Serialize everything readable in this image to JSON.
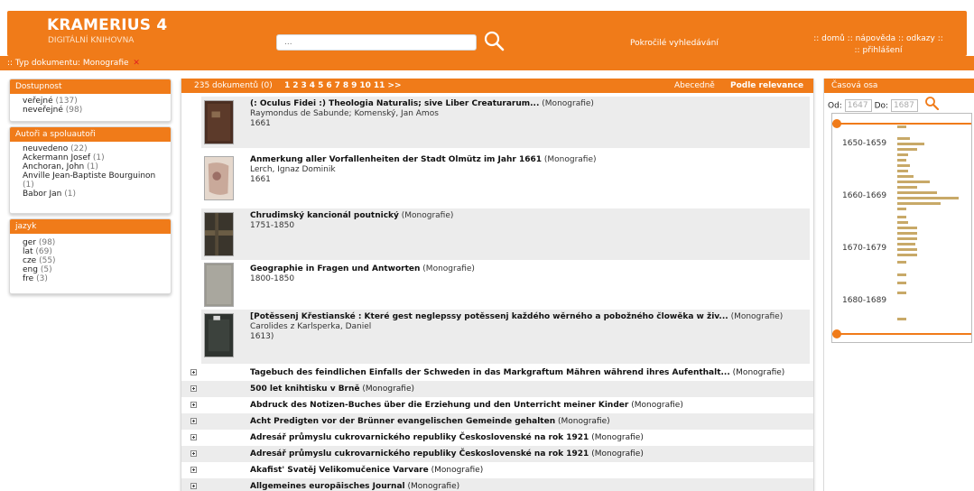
{
  "header": {
    "title": "KRAMERIUS 4",
    "subtitle": "DIGITÁLNÍ KNIHOVNA",
    "search_placeholder": "...",
    "advanced_search": "Pokročilé vyhledávání",
    "links_line1_a": ":: domů ::",
    "links_line1_b": "nápověda",
    "links_line1_c": "::",
    "links_line1_d": "odkazy",
    "links_line1_e": "::",
    "links_line2_a": "::",
    "links_line2_b": "přihlášení"
  },
  "breadcrumb": {
    "text": ":: Typ dokumentu: Monografie",
    "remove_icon": "close-x-icon"
  },
  "facets": {
    "availability": {
      "title": "Dostupnost",
      "items": [
        {
          "label": "veřejné",
          "count": "(137)"
        },
        {
          "label": "neveřejné",
          "count": "(98)"
        }
      ]
    },
    "authors": {
      "title": "Autoři a spoluautoři",
      "items": [
        {
          "label": "neuvedeno",
          "count": "(22)"
        },
        {
          "label": "Ackermann Josef",
          "count": "(1)"
        },
        {
          "label": "Anchoran, John",
          "count": "(1)"
        },
        {
          "label": "Anville Jean-Baptiste Bourguinon",
          "count": "(1)"
        },
        {
          "label": "Babor Jan",
          "count": "(1)"
        }
      ]
    },
    "language": {
      "title": "jazyk",
      "items": [
        {
          "label": "ger",
          "count": "(98)"
        },
        {
          "label": "lat",
          "count": "(69)"
        },
        {
          "label": "cze",
          "count": "(55)"
        },
        {
          "label": "eng",
          "count": "(5)"
        },
        {
          "label": "fre",
          "count": "(3)"
        }
      ]
    }
  },
  "results": {
    "count_text": "235 dokumentů (0)",
    "pages": [
      "1",
      "2",
      "3",
      "4",
      "5",
      "6",
      "7",
      "8",
      "9",
      "10",
      "11",
      ">>"
    ],
    "sort_alpha": "Abecedně",
    "sort_relevance": "Podle relevance",
    "items_with_thumbs": [
      {
        "title": "(: Oculus Fidei :) Theologia Naturalis; sive Liber Creaturarum...",
        "type": "(Monografie)",
        "authors": "Raymondus de Sabunde; Komenský, Jan Amos",
        "year": "1661"
      },
      {
        "title": "Anmerkung aller Vorfallenheiten der Stadt Olmütz im Jahr 1661",
        "type": "(Monografie)",
        "authors": "Lerch, Ignaz Dominik",
        "year": "1661"
      },
      {
        "title": "Chrudimský kancionál poutnický",
        "type": "(Monografie)",
        "authors": "",
        "year": "1751-1850"
      },
      {
        "title": "Geographie in Fragen und Antworten",
        "type": "(Monografie)",
        "authors": "",
        "year": "1800-1850"
      },
      {
        "title": "[Potěssenj Křestianské : Které gest neglepssy potěssenj každého wěrného a pobožného člowěka w živ...",
        "type": "(Monografie)",
        "authors": "Carolides z Karlsperka, Daniel",
        "year": "1613)"
      }
    ],
    "items_collapsed": [
      {
        "title": "Tagebuch des feindlichen Einfalls der Schweden in das Markgraftum Mähren während ihres Aufenthalt...",
        "type": "(Monografie)"
      },
      {
        "title": "500 let knihtisku v Brně",
        "type": "(Monografie)"
      },
      {
        "title": "Abdruck des Notizen-Buches über die Erziehung und den Unterricht meiner Kinder",
        "type": "(Monografie)"
      },
      {
        "title": "Acht Predigten vor der Brünner evangelischen Gemeinde gehalten",
        "type": "(Monografie)"
      },
      {
        "title": "Adresář průmyslu cukrovarnického republiky Československé na rok 1921",
        "type": "(Monografie)"
      },
      {
        "title": "Adresář průmyslu cukrovarnického republiky Československé na rok 1921",
        "type": "(Monografie)"
      },
      {
        "title": "Akafist' Svatěj Velikomučenice Varvare",
        "type": "(Monografie)"
      },
      {
        "title": "Allgemeines europäisches Journal",
        "type": "(Monografie)"
      }
    ]
  },
  "timeline": {
    "title": "Časová osa",
    "from_label": "Od:",
    "from_value": "1647",
    "to_label": "Do:",
    "to_value": "1687",
    "decades": [
      "1650-1659",
      "1660-1669",
      "1670-1679",
      "1680-1689"
    ]
  },
  "colors": {
    "accent": "#f07b19",
    "bar": "#c8a968",
    "row_shade": "#ececec"
  }
}
